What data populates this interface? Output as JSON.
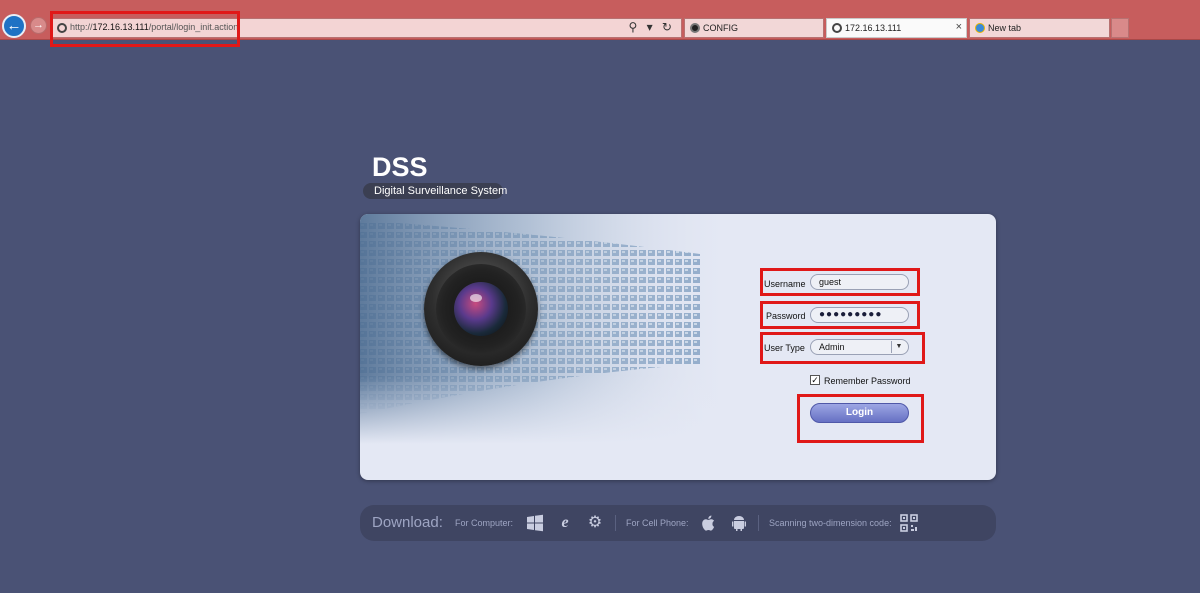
{
  "browser": {
    "address_url_prefix": "http://",
    "address_url_host": "172.16.13.111",
    "address_url_path": "/portal/login_init.action",
    "address_tools": "⚲ ▾ ↻",
    "tabs": [
      {
        "label": "CONFIG"
      },
      {
        "label": "172.16.13.111",
        "close": "×"
      },
      {
        "label": "New tab"
      }
    ]
  },
  "logo": {
    "title": "DSS",
    "subtitle": "Digital Surveillance System"
  },
  "login": {
    "username_label": "Username",
    "username_value": "guest",
    "password_label": "Password",
    "password_dots": "●●●●●●●●●",
    "user_type_label": "User Type",
    "user_type_value": "Admin",
    "remember_label": "Remember Password",
    "remember_checked": true,
    "login_button": "Login"
  },
  "download": {
    "title": "Download:",
    "for_computer": "For Computer:",
    "for_cell_phone": "For Cell Phone:",
    "scanning": "Scanning two-dimension code:"
  },
  "colors": {
    "background": "#4a5275",
    "chrome": "#c75d5d",
    "annotation": "#e01818",
    "login_button": "#7a83d3"
  }
}
